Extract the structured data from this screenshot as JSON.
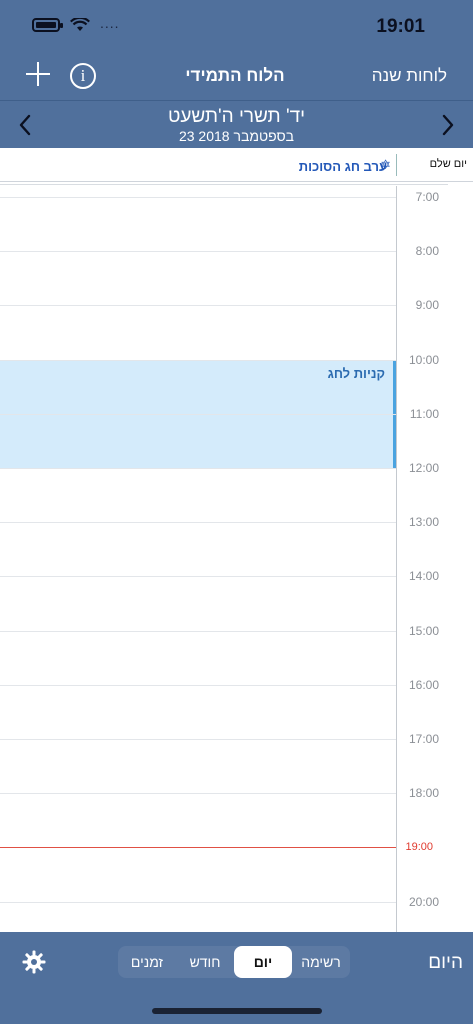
{
  "status": {
    "time": "19:01",
    "signal": "...."
  },
  "header": {
    "title": "הלוח התמידי",
    "year_tables": "לוחות שנה",
    "info_glyph": "i",
    "hebrew_date": "יד' תשרי ה'תשעט",
    "gregorian_date": "23 בספטמבר 2018"
  },
  "allday": {
    "label": "יום שלם",
    "event_title": "ערב חג הסוכות",
    "event_icon": "✡"
  },
  "hours": [
    "7:00",
    "8:00",
    "9:00",
    "10:00",
    "11:00",
    "12:00",
    "13:00",
    "14:00",
    "15:00",
    "16:00",
    "17:00",
    "18:00",
    "19:00",
    "20:00"
  ],
  "current_time_label": "19:00",
  "event": {
    "title": "קניות לחג",
    "start": "10:00",
    "end": "12:00"
  },
  "tabs": [
    {
      "label": "זמנים",
      "active": false
    },
    {
      "label": "חודש",
      "active": false
    },
    {
      "label": "יום",
      "active": true
    },
    {
      "label": "רשימה",
      "active": false
    }
  ],
  "today_label": "היום",
  "colors": {
    "header_bg": "#50709c",
    "event_bg": "#d4ebfb",
    "event_accent": "#4aa3e0",
    "current_time": "#e05044"
  }
}
